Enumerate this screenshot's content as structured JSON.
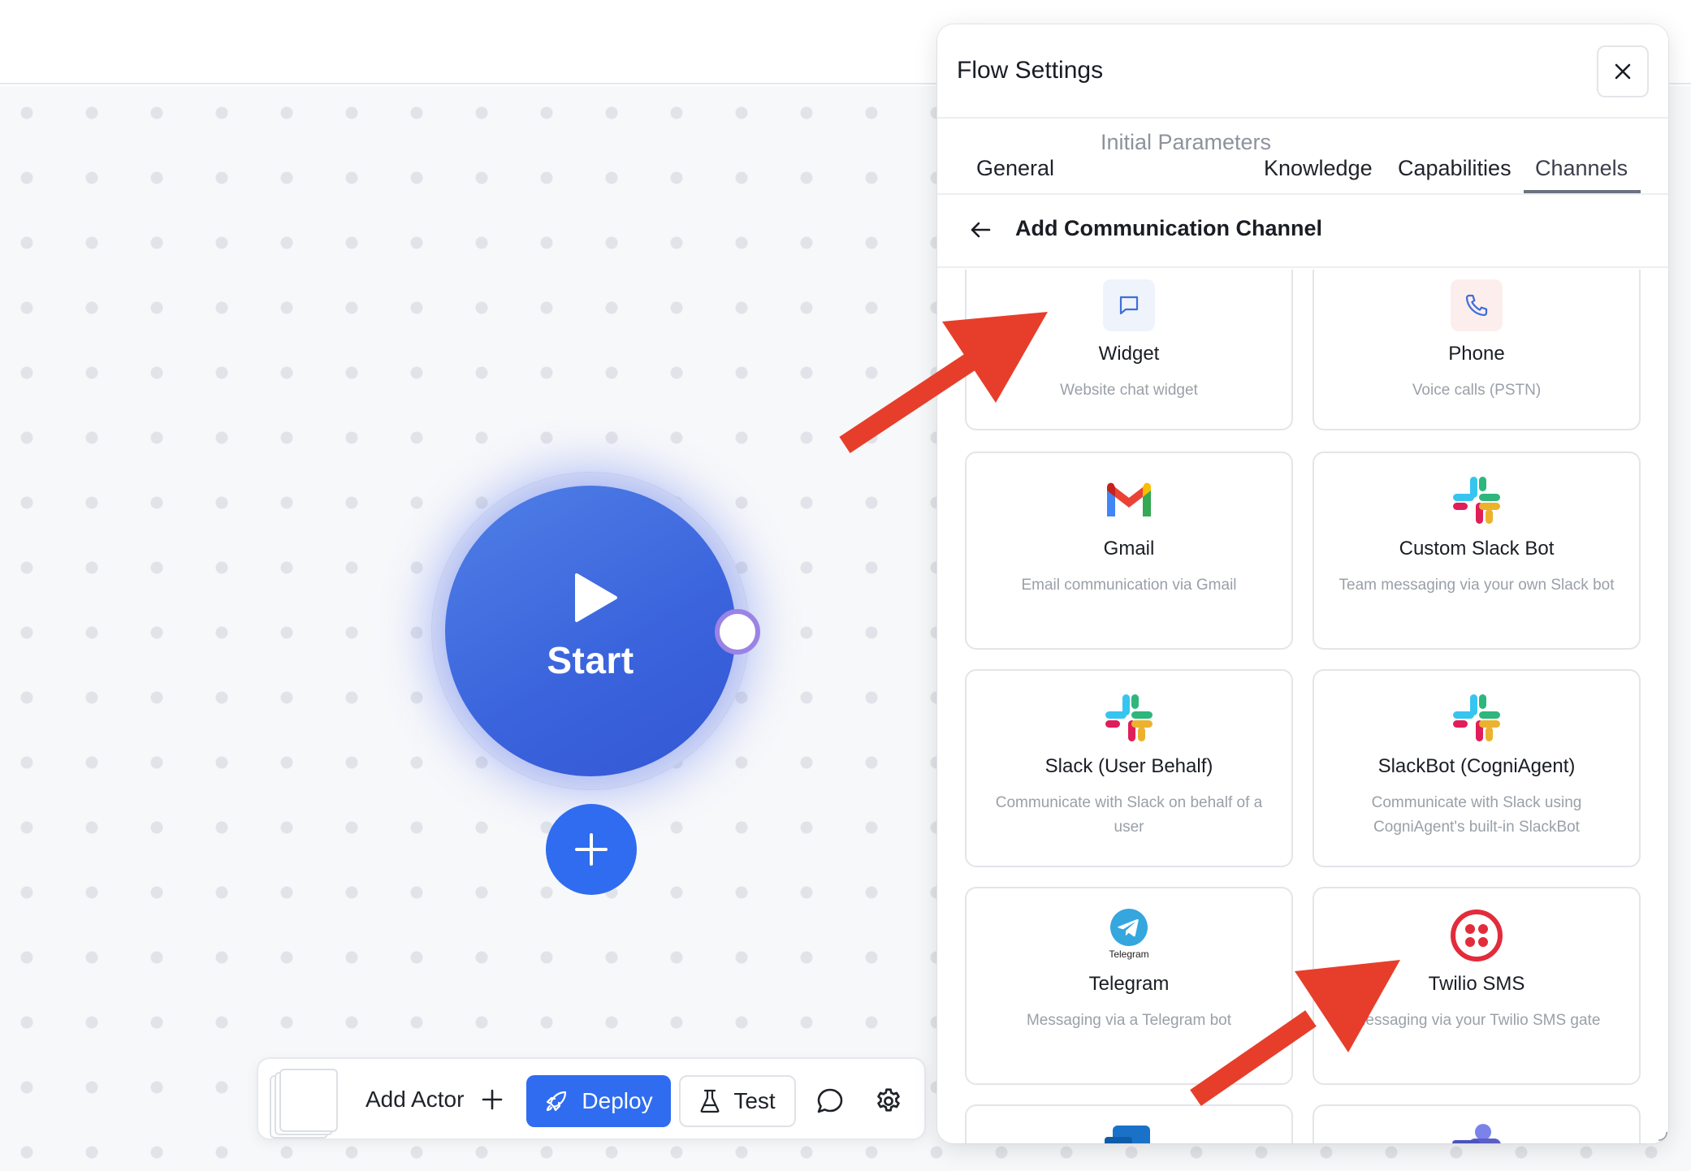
{
  "canvas": {
    "start_label": "Start"
  },
  "toolbar": {
    "add_actor_label": "Add Actor",
    "deploy_label": "Deploy",
    "test_label": "Test"
  },
  "panel": {
    "title": "Flow Settings",
    "tabs": [
      {
        "label": "General"
      },
      {
        "label": "Initial Parameters"
      },
      {
        "label": "Knowledge"
      },
      {
        "label": "Capabilities"
      },
      {
        "label": "Channels"
      }
    ],
    "active_tab": "Channels",
    "subheader_title": "Add Communication Channel",
    "channels": [
      {
        "name": "Widget",
        "description": "Website chat widget",
        "icon": "chat-bubble-icon"
      },
      {
        "name": "Phone",
        "description": "Voice calls (PSTN)",
        "icon": "phone-icon"
      },
      {
        "name": "Gmail",
        "description": "Email communication via Gmail",
        "icon": "gmail-icon"
      },
      {
        "name": "Custom Slack Bot",
        "description": "Team messaging via your own Slack bot",
        "icon": "slack-icon"
      },
      {
        "name": "Slack (User Behalf)",
        "description": "Communicate with Slack on behalf of a user",
        "icon": "slack-icon"
      },
      {
        "name": "SlackBot (CogniAgent)",
        "description": "Communicate with Slack using CogniAgent's built-in SlackBot",
        "icon": "slack-icon"
      },
      {
        "name": "Telegram",
        "description": "Messaging via a Telegram bot",
        "icon": "telegram-icon",
        "icon_caption": "Telegram"
      },
      {
        "name": "Twilio SMS",
        "description": "messaging via your Twilio SMS gate",
        "icon": "twilio-icon"
      },
      {
        "name": "",
        "description": "",
        "icon": "outlook-icon",
        "icon_letter": "O"
      },
      {
        "name": "",
        "description": "",
        "icon": "teams-icon",
        "icon_letter": "T"
      }
    ]
  },
  "colors": {
    "accent": "#2f6cf0",
    "start_node": "#3a63dc",
    "annotation_arrow": "#e63e2b",
    "handle_ring": "#9b83e6"
  }
}
